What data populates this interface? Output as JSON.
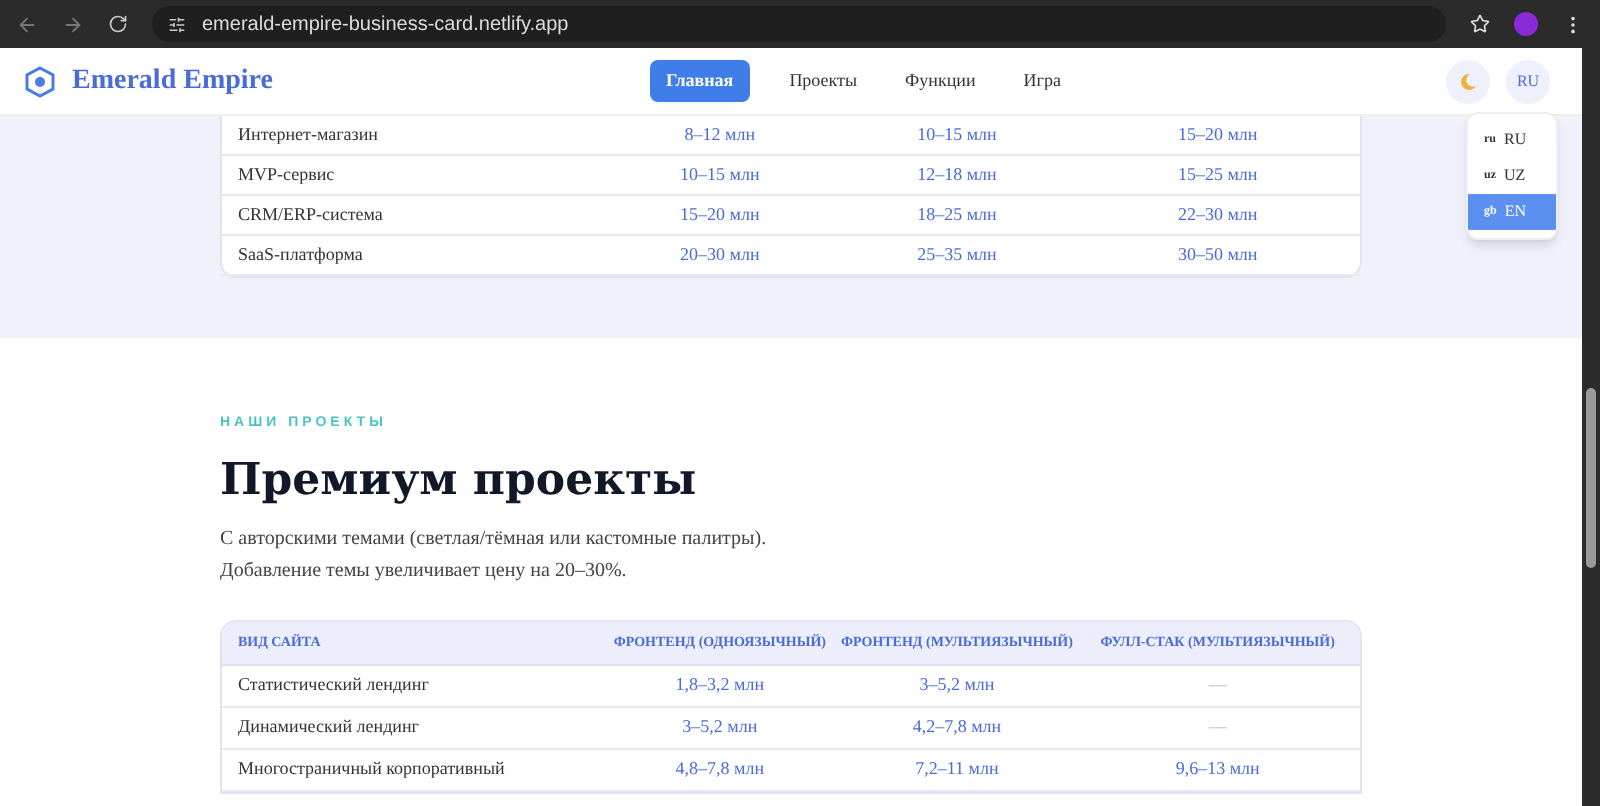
{
  "browser": {
    "url": "emerald-empire-business-card.netlify.app"
  },
  "nav": {
    "logo": "Emerald Empire",
    "links": [
      {
        "label": "Главная",
        "selected": true
      },
      {
        "label": "Проекты",
        "selected": false
      },
      {
        "label": "Функции",
        "selected": false
      },
      {
        "label": "Игра",
        "selected": false
      }
    ],
    "lang_button": "RU",
    "lang_menu": [
      {
        "flag": "ru",
        "label": "RU",
        "selected": false
      },
      {
        "flag": "uz",
        "label": "UZ",
        "selected": false
      },
      {
        "flag": "gb",
        "label": "EN",
        "selected": true
      }
    ]
  },
  "pricing_table": {
    "rows": [
      {
        "cells": [
          "Интернет-магазин",
          "8–12 млн",
          "10–15 млн",
          "15–20 млн"
        ]
      },
      {
        "cells": [
          "MVP-сервис",
          "10–15 млн",
          "12–18 млн",
          "15–25 млн"
        ]
      },
      {
        "cells": [
          "CRM/ERP-система",
          "15–20 млн",
          "18–25 млн",
          "22–30 млн"
        ]
      },
      {
        "cells": [
          "SaaS-платформа",
          "20–30 млн",
          "25–35 млн",
          "30–50 млн"
        ]
      }
    ]
  },
  "projects": {
    "eyebrow": "НАШИ ПРОЕКТЫ",
    "title": "Премиум проекты",
    "description": [
      "С авторскими темами (светлая/тёмная или кастомные палитры).",
      "Добавление темы увеличивает цену на 20–30%."
    ],
    "table": {
      "columns": [
        "ВИД САЙТА",
        "ФРОНТЕНД (ОДНОЯЗЫЧНЫЙ)",
        "ФРОНТЕНД (МУЛЬТИЯЗЫЧНЫЙ)",
        "ФУЛЛ-СТАК (МУЛЬТИЯЗЫЧНЫЙ)"
      ],
      "rows": [
        {
          "cells": [
            "Статистический лендинг",
            "1,8–3,2 млн",
            "3–5,2 млн",
            "—"
          ]
        },
        {
          "cells": [
            "Динамический лендинг",
            "3–5,2 млн",
            "4,2–7,8 млн",
            "—"
          ]
        },
        {
          "cells": [
            "Многостраничный корпоративный",
            "4,8–7,8 млн",
            "7,2–11 млн",
            "9,6–13 млн"
          ]
        }
      ]
    }
  }
}
